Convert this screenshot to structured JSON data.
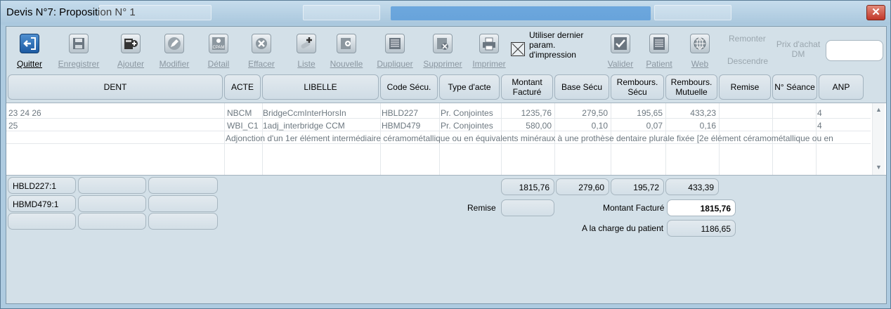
{
  "window": {
    "title": "Devis N°7: Proposition N° 1",
    "close_symbol": "✕"
  },
  "toolbar": {
    "tools": [
      {
        "key": "quitter",
        "label": "Quitter",
        "icon": "exit-door-icon",
        "active": true
      },
      {
        "key": "enregistrer",
        "label": "Enregistrer",
        "icon": "floppy-disk-icon"
      },
      {
        "key": "ajouter",
        "label": "Ajouter",
        "icon": "calculator-add-icon"
      },
      {
        "key": "modifier",
        "label": "Modifier",
        "icon": "pencil-icon"
      },
      {
        "key": "detail",
        "label": "Détail",
        "icon": "cpam-detail-icon"
      },
      {
        "key": "effacer",
        "label": "Effacer",
        "icon": "clear-x-icon"
      },
      {
        "key": "liste",
        "label": "Liste",
        "icon": "bandage-plus-icon"
      },
      {
        "key": "nouvelle",
        "label": "Nouvelle",
        "icon": "new-sheet-icon"
      },
      {
        "key": "dupliquer",
        "label": "Dupliquer",
        "icon": "duplicate-doc-icon"
      },
      {
        "key": "supprimer",
        "label": "Supprimer",
        "icon": "delete-doc-icon"
      },
      {
        "key": "imprimer",
        "label": "Imprimer",
        "icon": "printer-icon"
      },
      {
        "key": "valider",
        "label": "Valider",
        "icon": "validate-check-icon"
      },
      {
        "key": "patient",
        "label": "Patient",
        "icon": "patient-doc-icon"
      },
      {
        "key": "web",
        "label": "Web",
        "icon": "globe-icon"
      }
    ],
    "print_option": {
      "label": "Utiliser dernier param. d'impression",
      "checked": true
    },
    "monter_label": "Remonter",
    "descendre_label": "Descendre",
    "prix_label": "Prix d'achat DM",
    "prix_value": ""
  },
  "table": {
    "headers": [
      "DENT",
      "ACTE",
      "LIBELLE",
      "Code Sécu.",
      "Type d'acte",
      "Montant Facturé",
      "Base Sécu",
      "Rembours. Sécu",
      "Rembours. Mutuelle",
      "Remise",
      "N° Séance",
      "ANP"
    ],
    "rows": [
      {
        "dent": "23 24 26",
        "acte": "NBCM",
        "libelle": "BridgeCcmInterHorsIn",
        "code": "HBLD227",
        "type": "Pr. Conjointes",
        "montant": "1235,76",
        "base": "279,50",
        "rsecu": "195,65",
        "rmut": "433,23",
        "remise": "",
        "seance": "",
        "anp": "4"
      },
      {
        "dent": "25",
        "acte": "WBI_C1",
        "libelle": "1adj_interbridge CCM",
        "code": "HBMD479",
        "type": "Pr. Conjointes",
        "montant": "580,00",
        "base": "0,10",
        "rsecu": "0,07",
        "rmut": "0,16",
        "remise": "",
        "seance": "",
        "anp": "4"
      }
    ],
    "description": "Adjonction d'un 1er élément intermédiaire céramométallique ou en équivalents minéraux à une prothèse dentaire plurale fixée [2e élément céramométallique ou en"
  },
  "codes": [
    "HBLD227:1",
    "HBMD479:1"
  ],
  "totals": {
    "montant": "1815,76",
    "base": "279,60",
    "rsecu": "195,72",
    "rmut": "433,39"
  },
  "summary": {
    "remise_label": "Remise",
    "remise_value": "",
    "montant_label": "Montant Facturé",
    "montant_value": "1815,76",
    "patient_label": "A la charge du patient",
    "patient_value": "1186,65"
  }
}
